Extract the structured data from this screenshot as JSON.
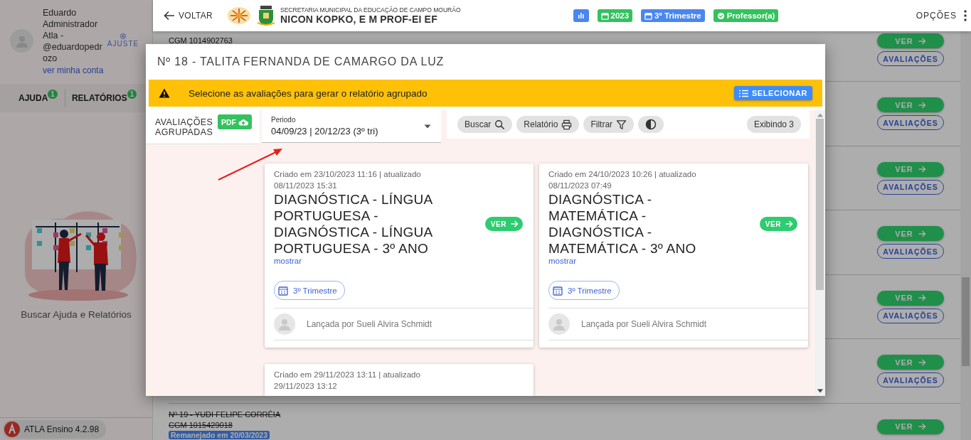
{
  "sidebar": {
    "user": {
      "name": "Eduardo Administrador Atla - @eduardopedrozo",
      "account_link": "ver minha conta",
      "settings": "AJUSTE"
    },
    "tabs": [
      {
        "label": "AJUDA",
        "badge": "1",
        "selected": false
      },
      {
        "label": "RELATÓRIOS",
        "badge": "1",
        "selected": false
      }
    ],
    "empty_message": "Buscar Ajuda e Relatórios",
    "version": "ATLA Ensino 4.2.98"
  },
  "topbar": {
    "back": "VOLTAR",
    "org": "SECRETARIA MUNICIPAL DA EDUCAÇÃO DE CAMPO MOURÃO",
    "school": "NICON KOPKO, E M PROF-EI EF",
    "chips": [
      {
        "kind": "chart",
        "color": "#4a86f0"
      },
      {
        "kind": "calendar",
        "label": "2023",
        "color": "#33c25e"
      },
      {
        "kind": "calendar",
        "label": "3º Trimestre",
        "color": "#4a86f0"
      },
      {
        "kind": "check",
        "label": "Professor(a)",
        "color": "#33c25e"
      }
    ],
    "options": "OPÇÕES"
  },
  "students": [
    {
      "cgm": "CGM 1014902763",
      "removed": false,
      "buttons": [
        {
          "kind": "primary",
          "label": "VER"
        },
        {
          "kind": "outline",
          "label": "AVALIAÇÕES"
        }
      ]
    },
    {
      "buttons": [
        {
          "kind": "primary",
          "label": "VER"
        },
        {
          "kind": "outline",
          "label": "AVALIAÇÕES"
        }
      ]
    },
    {
      "buttons": [
        {
          "kind": "primary",
          "label": "VER"
        },
        {
          "kind": "outline",
          "label": "AVALIAÇÕES"
        }
      ]
    },
    {
      "buttons": [
        {
          "kind": "primary",
          "label": "VER"
        },
        {
          "kind": "outline",
          "label": "AVALIAÇÕES"
        }
      ]
    },
    {
      "buttons": [
        {
          "kind": "primary",
          "label": "VER"
        },
        {
          "kind": "outline",
          "label": "AVALIAÇÕES"
        }
      ]
    },
    {
      "buttons": [
        {
          "kind": "primary",
          "label": "VER"
        },
        {
          "kind": "outline",
          "label": "AVALIAÇÕES"
        }
      ]
    },
    {
      "name": "Nº 19 - YUDI FELIPE CORRÊIA",
      "cgm": "CGM 1015429018",
      "badge": "Remanejado em 20/03/2023",
      "removed": true,
      "buttons": [
        {
          "kind": "primary",
          "label": "VER"
        }
      ]
    }
  ],
  "modal": {
    "title": "Nº 18 - TALITA FERNANDA DE CAMARGO DA LUZ",
    "alert": {
      "message": "Selecione as avaliações para gerar o relatório agrupado",
      "button": "SELECIONAR"
    },
    "group_label": "AVALIAÇÕES AGRUPADAS",
    "pdf_button": "PDF",
    "period": {
      "label": "Periodo",
      "value": "04/09/23 | 20/12/23 (3º tri)"
    },
    "toolbar": [
      {
        "kind": "search",
        "label": "Buscar"
      },
      {
        "kind": "print",
        "label": "Relatório"
      },
      {
        "kind": "filter",
        "label": "Filtrar"
      },
      {
        "kind": "contrast"
      }
    ],
    "count": "Exibindo 3",
    "cards": [
      {
        "created": "Criado em 23/10/2023 11:16 | atualizado 08/11/2023 15:31",
        "title": "DIAGNÓSTICA - LÍNGUA PORTUGUESA - DIAGNÓSTICA - LÍNGUA PORTUGUESA - 3º ANO",
        "button": "VER",
        "more": "mostrar",
        "tag": "3º Trimestre",
        "author": "Lançada por Sueli Alvira Schmidt"
      },
      {
        "created": "Criado em 24/10/2023 10:26 | atualizado 08/11/2023 07:49",
        "title": "DIAGNÓSTICA - MATEMÁTICA - DIAGNÓSTICA - MATEMÁTICA - 3º ANO",
        "button": "VER",
        "more": "mostrar",
        "tag": "3º Trimestre",
        "author": "Lançada por Sueli Alvira Schmidt"
      },
      {
        "created": "Criado em 29/11/2023 13:11 | atualizado 29/11/2023 13:12"
      }
    ]
  },
  "annotation": {
    "kind": "arrow"
  }
}
